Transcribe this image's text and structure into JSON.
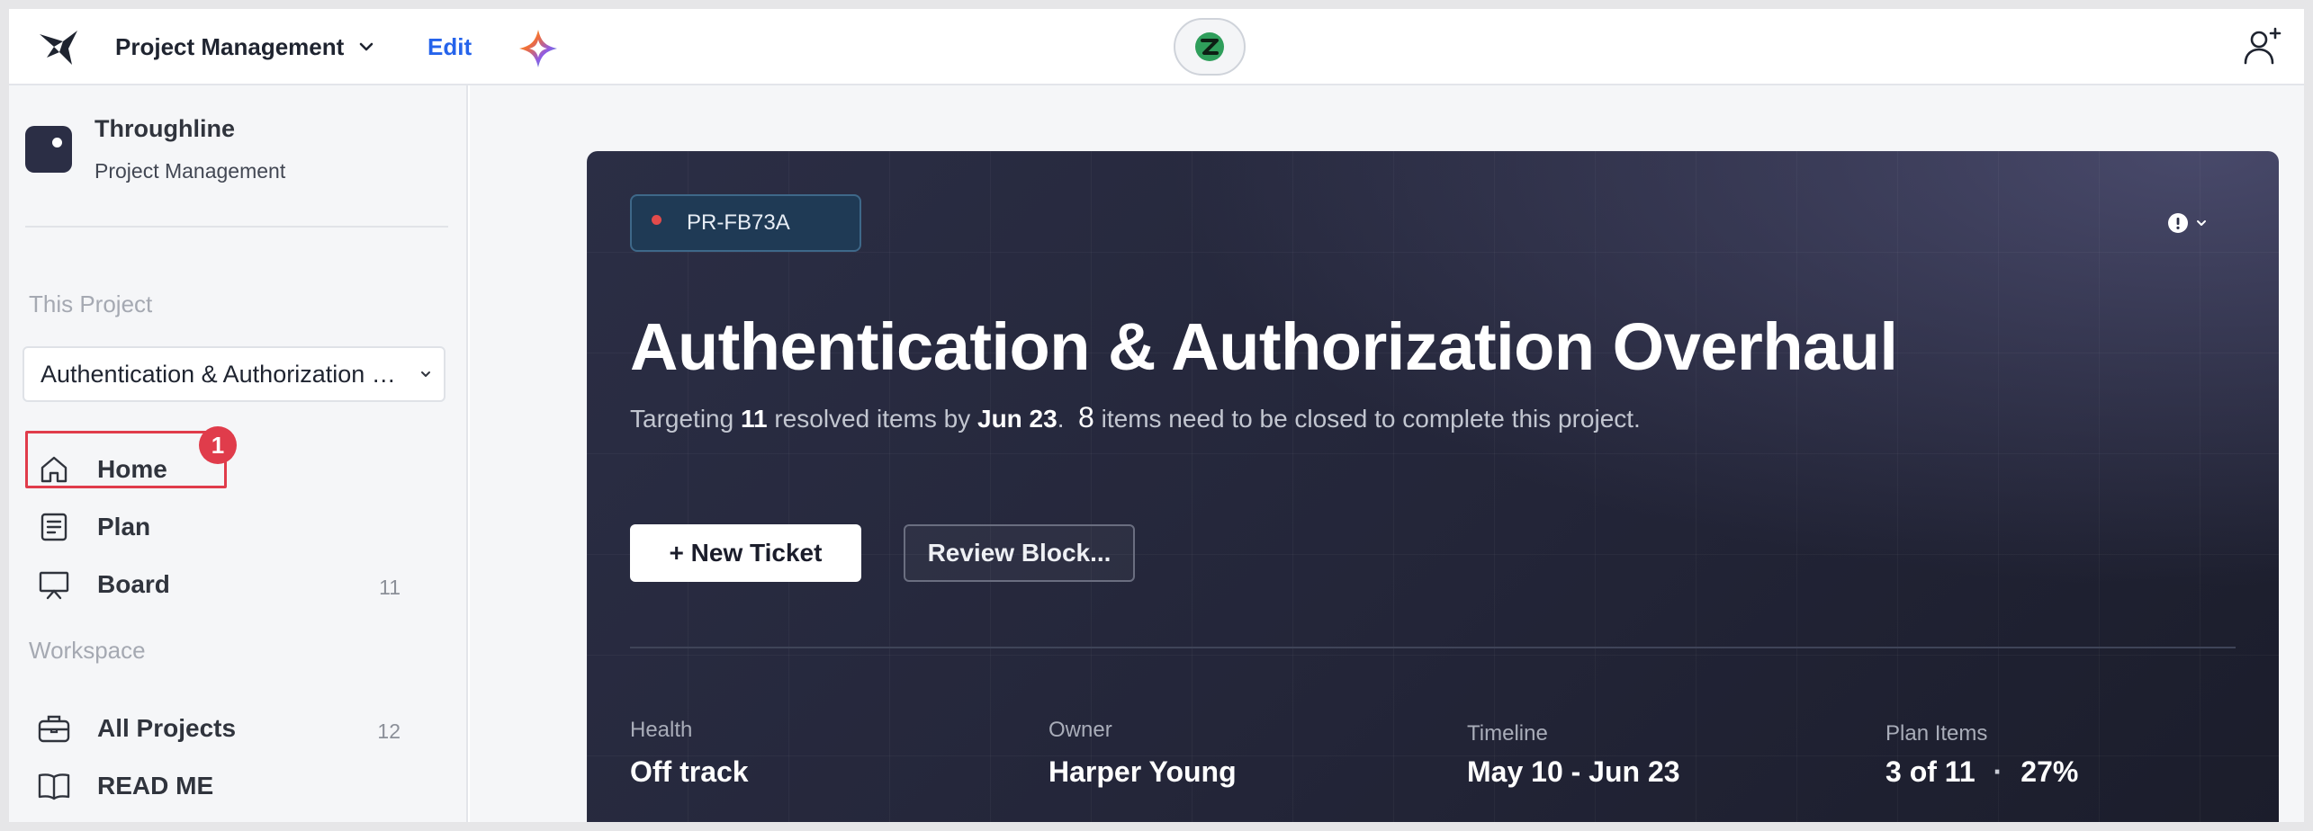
{
  "topbar": {
    "app_title": "Project Management",
    "edit_label": "Edit",
    "logo_icon": "bird-logo-icon",
    "ai_icon": "sparkle-icon",
    "center_icon": "assistant-icon",
    "add_user_icon": "add-user-icon"
  },
  "sidebar": {
    "org_name": "Throughline",
    "org_subtitle": "Project Management",
    "section_project": "This Project",
    "project_select_value": "Authentication & Authorization Overhaul",
    "project_items": [
      {
        "label": "Home",
        "icon": "home-icon",
        "count": ""
      },
      {
        "label": "Plan",
        "icon": "list-icon",
        "count": ""
      },
      {
        "label": "Board",
        "icon": "board-icon",
        "count": "11"
      }
    ],
    "section_workspace": "Workspace",
    "workspace_items": [
      {
        "label": "All Projects",
        "icon": "briefcase-icon",
        "count": "12"
      },
      {
        "label": "READ ME",
        "icon": "book-icon",
        "count": ""
      }
    ],
    "annotation_marker": "1"
  },
  "hero": {
    "project_id": "PR-FB73A",
    "title": "Authentication & Authorization Overhaul",
    "subtitle": {
      "prefix": "Targeting ",
      "resolved_count": "11",
      "mid": " resolved items by ",
      "due_date": "Jun 23",
      "dot": ".",
      "remaining_count": "8",
      "suffix": " items need to be closed to complete this project."
    },
    "primary_button": "+ New Ticket",
    "secondary_button": "Review Block...",
    "stats": [
      {
        "label": "Health",
        "value": "Off track"
      },
      {
        "label": "Owner",
        "value": "Harper Young"
      },
      {
        "label": "Timeline",
        "value": "May 10 - Jun 23"
      },
      {
        "label": "Plan Items",
        "value": "3 of 11",
        "extra": "27%"
      }
    ]
  },
  "colors": {
    "accent_blue": "#2563eb",
    "annotation_red": "#e03c4b",
    "hero_bg": "#2b2e45",
    "status_dot": "#e24b4b"
  }
}
